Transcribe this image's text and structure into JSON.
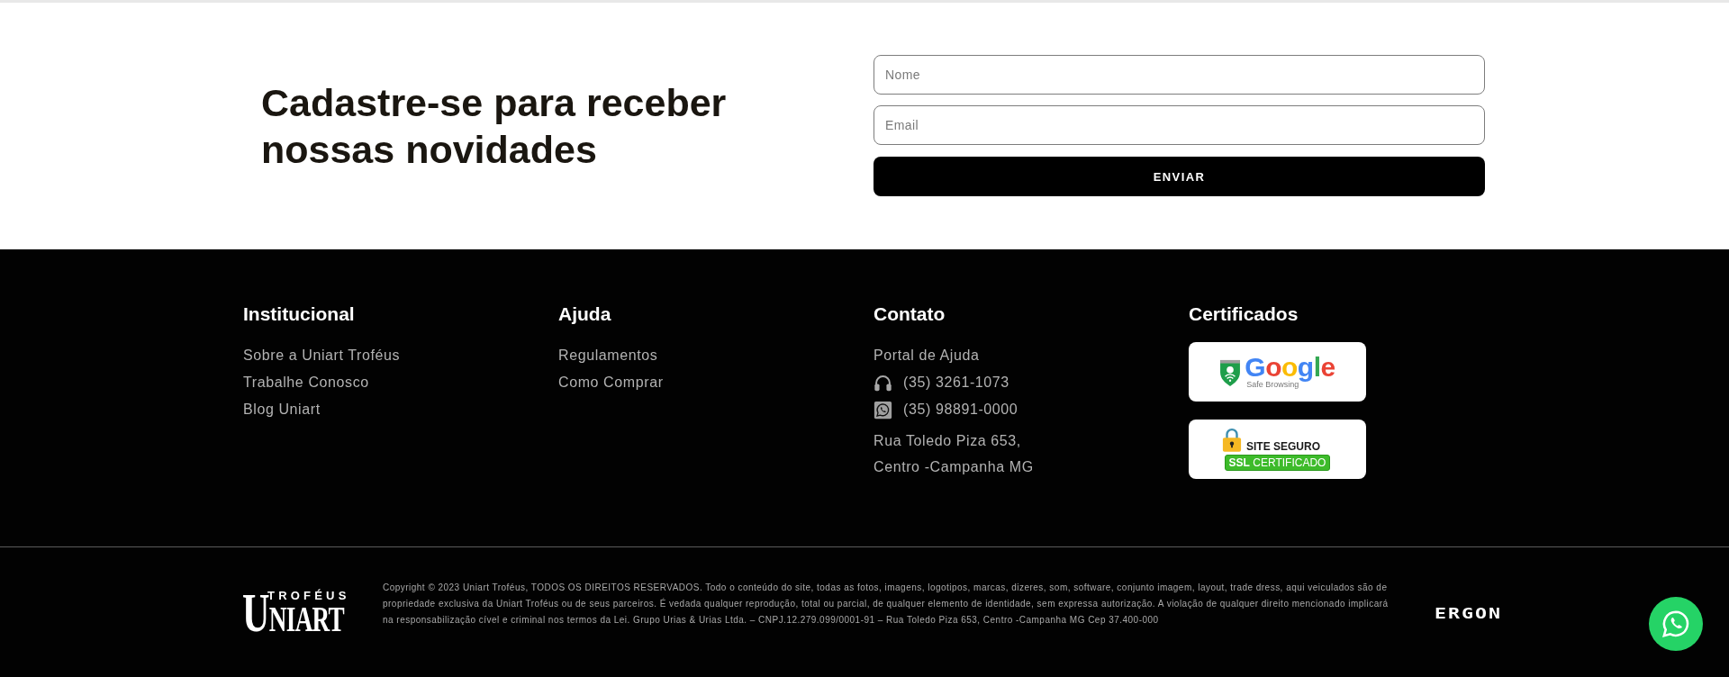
{
  "signup": {
    "title": "Cadastre-se para receber nossas novidades",
    "fields": [
      {
        "placeholder": "Nome"
      },
      {
        "placeholder": "Email"
      }
    ],
    "submit": "ENVIAR"
  },
  "footer": {
    "columns": [
      {
        "kind": "links",
        "title": "Institucional",
        "links": [
          "Sobre a Uniart Troféus",
          "Trabalhe Conosco",
          "Blog Uniart"
        ]
      },
      {
        "kind": "links",
        "title": "Ajuda",
        "links": [
          "Regulamentos",
          "Como Comprar"
        ]
      },
      {
        "kind": "contact",
        "title": "Contato",
        "items": [
          {
            "kind": "link",
            "text": "Portal de Ajuda"
          },
          {
            "kind": "phone",
            "text": "(35) 3261-1073"
          },
          {
            "kind": "whatsapp",
            "text": "(35) 98891-0000"
          }
        ],
        "address_lines": [
          "Rua Toledo Piza 653,",
          "Centro -Campanha MG"
        ]
      },
      {
        "kind": "certificates",
        "title": "Certificados",
        "badges": [
          {
            "kind": "google",
            "name": "Google",
            "subtitle": "Safe Browsing"
          },
          {
            "kind": "ssl",
            "title": "SITE SEGURO",
            "label": "**SSL** CERTIFICADO"
          }
        ]
      }
    ]
  },
  "bottom_bar": {
    "logo": {
      "tagline": "TROFÉUS",
      "wordmark": "UNIART"
    },
    "copyright": "Copyright © 2023 Uniart Troféus, TODOS OS DIREITOS RESERVADOS. Todo o conteúdo do site, todas as fotos, imagens, logotipos, marcas, dizeres, som, software, conjunto imagem, layout, trade dress, aqui veiculados são de propriedade exclusiva da Uniart Troféus ou de seus parceiros. É vedada qualquer reprodução, total ou parcial, de qualquer elemento de identidade, sem expressa autorização. A violação de qualquer direito mencionado implicará na responsabilização cível e criminal nos termos da Lei. Grupo Urias & Urias Ltda. – CNPJ.12.279.099/0001-91 – Rua Toledo Piza 653, Centro -Campanha MG Cep 37.400-000",
    "developer_logo": "ERGON"
  }
}
